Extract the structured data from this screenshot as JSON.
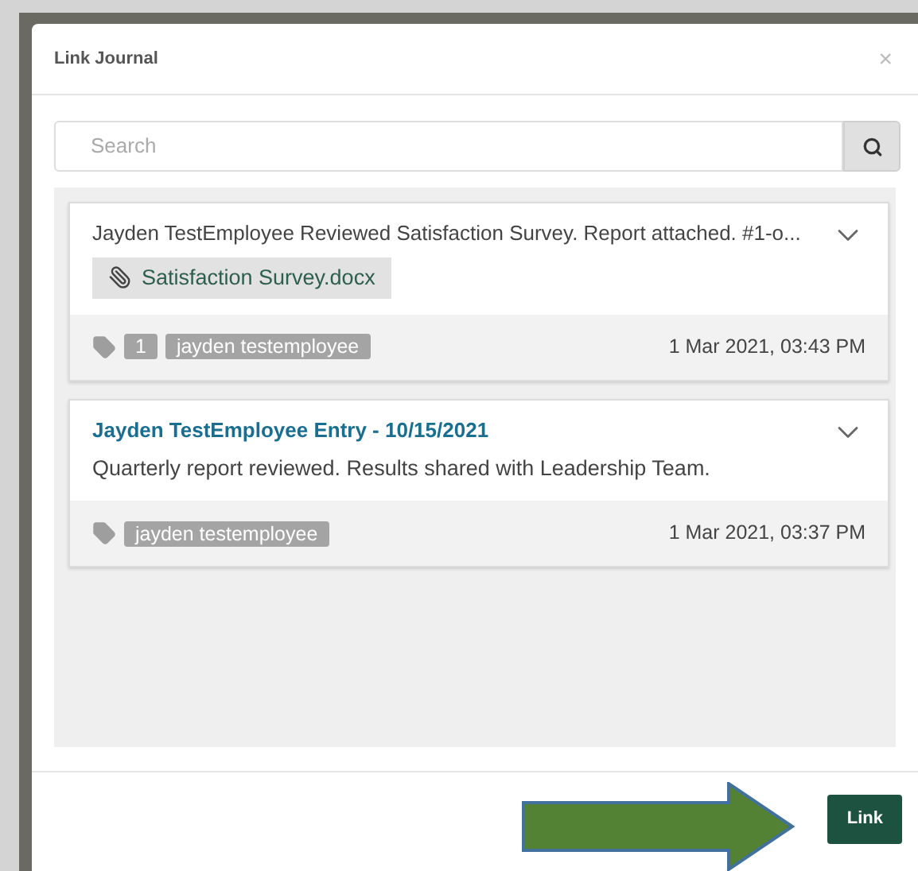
{
  "dialog": {
    "title": "Link Journal",
    "close": "×"
  },
  "search": {
    "placeholder": "Search"
  },
  "entries": [
    {
      "kind": "note",
      "title": "Jayden TestEmployee  Reviewed Satisfaction Survey. Report attached. #1-o...",
      "attachment": "Satisfaction Survey.docx",
      "tags": [
        "1",
        "jayden testemployee"
      ],
      "date": "1 Mar 2021, 03:43 PM"
    },
    {
      "kind": "entry",
      "title": "Jayden TestEmployee Entry - 10/15/2021",
      "body": "Quarterly report reviewed. Results shared with Leadership Team.",
      "tags": [
        "jayden testemployee"
      ],
      "date": "1 Mar 2021, 03:37 PM"
    }
  ],
  "footer": {
    "button": "Link"
  }
}
